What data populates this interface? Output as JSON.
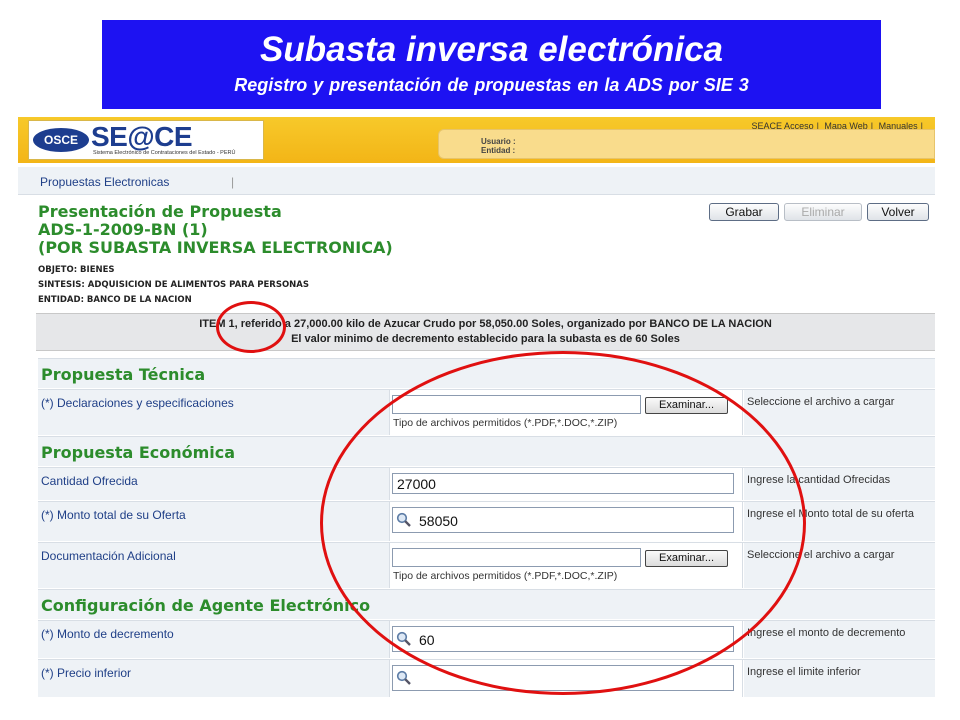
{
  "banner": {
    "title": "Subasta inversa electrónica",
    "subtitle": "Registro y presentación de propuestas en la ADS por SIE    3"
  },
  "header": {
    "logo_osce": "OSCE",
    "logo_seace": "SE@CE",
    "logo_sub": "Sistema Electrónico de Contrataciones del Estado - PERÚ",
    "links": [
      "SEACE Acceso",
      "Mapa Web",
      "Manuales"
    ],
    "user_label": "Usuario :",
    "entity_label": "Entidad :"
  },
  "nav": {
    "item": "Propuestas Electronicas",
    "separator": "|"
  },
  "heading": {
    "line1": "Presentación de Propuesta",
    "line2": "ADS-1-2009-BN (1)",
    "line3": "(POR SUBASTA INVERSA ELECTRONICA)",
    "objeto": "OBJETO: BIENES",
    "sintesis": "SINTESIS: ADQUISICION DE ALIMENTOS PARA PERSONAS",
    "entidad": "ENTIDAD: BANCO DE LA NACION"
  },
  "buttons": {
    "grabar": "Grabar",
    "eliminar": "Eliminar",
    "volver": "Volver"
  },
  "item_bar": {
    "line1": "ITEM 1, referido a 27,000.00 kilo de Azucar Crudo  por 58,050.00 Soles, organizado por BANCO DE LA NACION",
    "line2": "El valor minimo de decremento establecido para la subasta es de 60 Soles"
  },
  "form": {
    "sec_tecnica": "Propuesta Técnica",
    "sec_economica": "Propuesta Económica",
    "sec_agente": "Configuración de Agente Electrónico",
    "declaraciones_label": "(*) Declaraciones y especificaciones",
    "declaraciones_hint": "Seleccione el archivo a cargar",
    "examinar": "Examinar...",
    "file_types": "Tipo de archivos permitidos (*.PDF,*.DOC,*.ZIP)",
    "cantidad_label": "Cantidad Ofrecida",
    "cantidad_value": "27000",
    "cantidad_hint": "Ingrese la cantidad Ofrecidas",
    "monto_label": "(*) Monto total de su Oferta",
    "monto_value": "58050",
    "monto_hint": "Ingrese el Monto total de su oferta",
    "doc_label": "Documentación Adicional",
    "doc_hint": "Seleccione el archivo a cargar",
    "decremento_label": "(*) Monto de decremento",
    "decremento_value": "60",
    "decremento_hint": "Ingrese el monto de decremento",
    "precio_label": "(*) Precio inferior",
    "precio_value": "",
    "precio_hint": "Ingrese el limite inferior"
  },
  "colors": {
    "banner_bg": "#1d12f2",
    "heading_green": "#2c8c2c",
    "label_blue": "#1f3f87",
    "annotation_red": "#e01010",
    "header_yellow": "#f3b517"
  }
}
